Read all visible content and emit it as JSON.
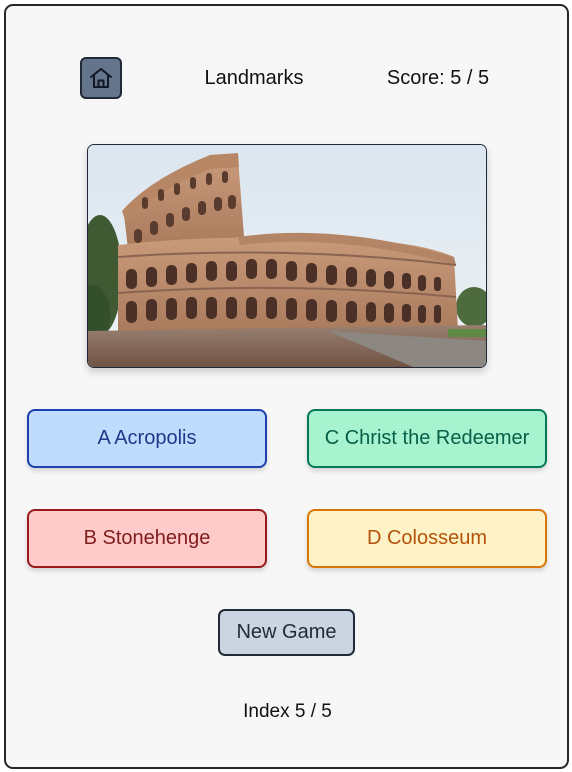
{
  "header": {
    "home_icon": "home-icon",
    "title": "Landmarks",
    "score": "Score: 5 / 5"
  },
  "photo": {
    "subject": "colosseum-photo"
  },
  "answers": [
    {
      "label": "A Acropolis"
    },
    {
      "label": "C Christ the Redeemer"
    },
    {
      "label": "B Stonehenge"
    },
    {
      "label": "D Colosseum"
    }
  ],
  "controls": {
    "new_game_label": "New Game"
  },
  "footer": {
    "index": "Index 5 / 5"
  },
  "colors": {
    "card_bg": "#f7f7f7",
    "home_btn": "#64748b",
    "answer_a_bg": "#bfdbfe",
    "answer_b_bg": "#fecaca",
    "answer_c_bg": "#a7f3d0",
    "answer_d_bg": "#fef3c7",
    "new_game_bg": "#cbd5e1"
  }
}
